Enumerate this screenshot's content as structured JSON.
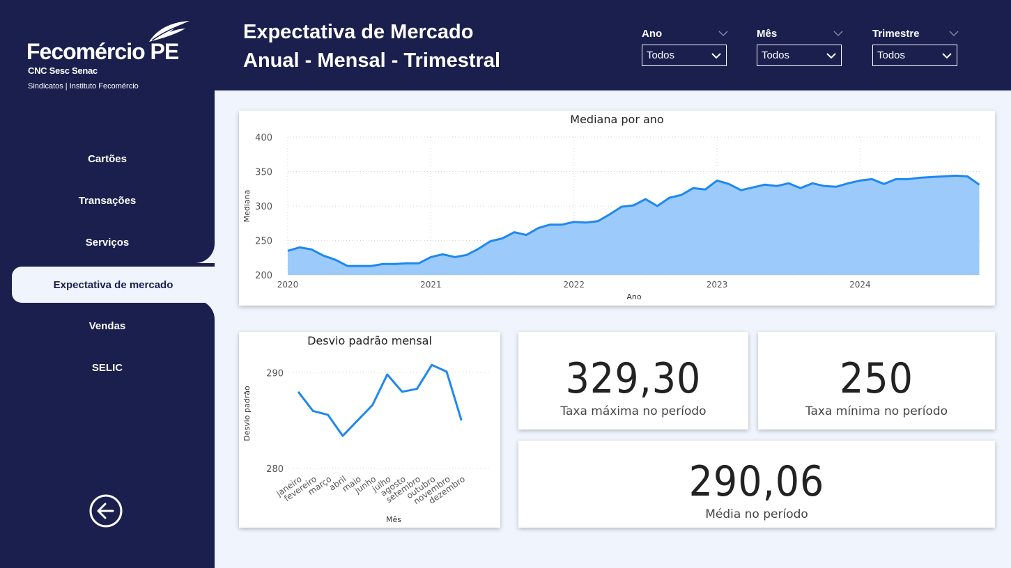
{
  "logo": {
    "brand": "Fecomércio PE",
    "partners": "CNC Sesc Senac",
    "sub": "Sindicatos  |  Instituto Fecomércio"
  },
  "nav": {
    "items": [
      {
        "label": "Cartões"
      },
      {
        "label": "Transações"
      },
      {
        "label": "Serviços"
      },
      {
        "label": "Expectativa de mercado"
      },
      {
        "label": "Vendas"
      },
      {
        "label": "SELIC"
      }
    ],
    "active_index": 3
  },
  "header": {
    "title_line1": "Expectativa de Mercado",
    "title_line2": "Anual - Mensal - Trimestral"
  },
  "filters": [
    {
      "label": "Ano",
      "value": "Todos"
    },
    {
      "label": "Mês",
      "value": "Todos"
    },
    {
      "label": "Trimestre",
      "value": "Todos"
    }
  ],
  "colors": {
    "navy": "#1a1f4e",
    "line": "#1e88f0",
    "area": "#9ccbfb",
    "canvas": "#f0f4fd"
  },
  "kpis": {
    "max": {
      "value": "329,30",
      "label": "Taxa máxima no período"
    },
    "min": {
      "value": "250",
      "label": "Taxa mínima no período"
    },
    "mean": {
      "value": "290,06",
      "label": "Média no período"
    }
  },
  "chart_data": [
    {
      "type": "area",
      "title": "Mediana por ano",
      "xlabel": "Ano",
      "ylabel": "Mediana",
      "ylim": [
        200,
        400
      ],
      "yticks": [
        200,
        250,
        300,
        350,
        400
      ],
      "xlim": [
        2020,
        2024.85
      ],
      "xticks": [
        2020,
        2021,
        2022,
        2023,
        2024
      ],
      "grid": true,
      "series": [
        {
          "x": [
            2020.0,
            2020.083,
            2020.167,
            2020.25,
            2020.333,
            2020.417,
            2020.5,
            2020.583,
            2020.667,
            2020.75,
            2020.833,
            2020.917,
            2021.0,
            2021.083,
            2021.167,
            2021.25,
            2021.333,
            2021.417,
            2021.5,
            2021.583,
            2021.667,
            2021.75,
            2021.833,
            2021.917,
            2022.0,
            2022.083,
            2022.167,
            2022.25,
            2022.333,
            2022.417,
            2022.5,
            2022.583,
            2022.667,
            2022.75,
            2022.833,
            2022.917,
            2023.0,
            2023.083,
            2023.167,
            2023.25,
            2023.333,
            2023.417,
            2023.5,
            2023.583,
            2023.667,
            2023.75,
            2023.833,
            2023.917,
            2024.0,
            2024.083,
            2024.167,
            2024.25,
            2024.333,
            2024.417,
            2024.5,
            2024.583,
            2024.667,
            2024.75,
            2024.833
          ],
          "values": [
            235,
            240,
            237,
            228,
            222,
            213,
            213,
            213,
            216,
            216,
            217,
            217,
            226,
            230,
            226,
            229,
            238,
            249,
            253,
            262,
            258,
            268,
            273,
            273,
            277,
            276,
            278,
            288,
            299,
            301,
            310,
            300,
            312,
            316,
            326,
            324,
            337,
            332,
            323,
            327,
            331,
            329,
            333,
            326,
            333,
            329,
            328,
            333,
            337,
            339,
            332,
            339,
            339,
            341,
            342,
            343,
            344,
            343,
            331
          ]
        }
      ]
    },
    {
      "type": "line",
      "title": "Desvio padrão mensal",
      "xlabel": "Mês",
      "ylabel": "Desvio padrão",
      "ylim": [
        279.2,
        292.2
      ],
      "yticks": [
        280,
        290
      ],
      "categories": [
        "janeiro",
        "fevereiro",
        "março",
        "abril",
        "maio",
        "junho",
        "julho",
        "agosto",
        "setembro",
        "outubro",
        "novembro",
        "dezembro"
      ],
      "series": [
        {
          "values": [
            288.0,
            286.0,
            285.6,
            283.4,
            285.0,
            286.6,
            289.8,
            288.0,
            288.3,
            290.8,
            290.1,
            285.0
          ]
        }
      ]
    }
  ]
}
